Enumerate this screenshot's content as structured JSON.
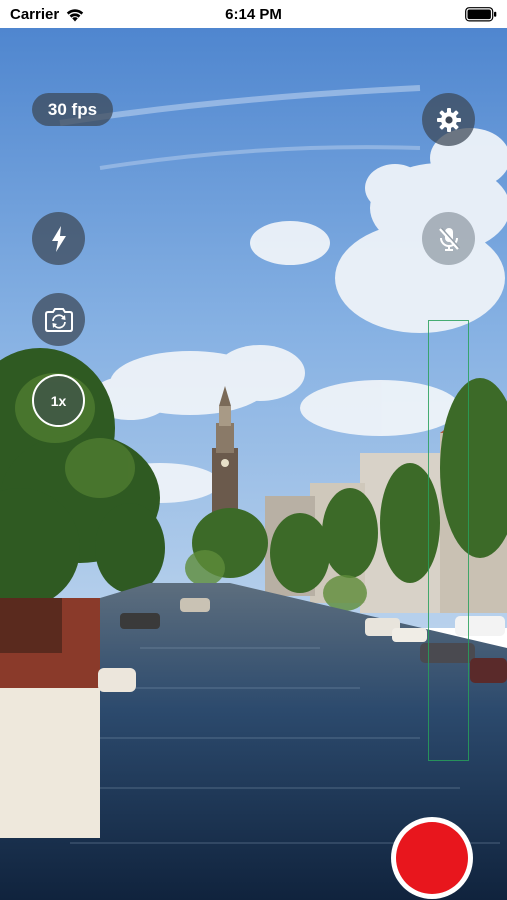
{
  "status_bar": {
    "carrier": "Carrier",
    "time": "6:14 PM",
    "icons": [
      "wifi-icon",
      "battery-icon"
    ]
  },
  "camera": {
    "fps_label": "30 fps",
    "zoom_label": "1x",
    "buttons": {
      "settings": "gear-icon",
      "flash": "lightning-icon",
      "switch_camera": "camera-rotate-icon",
      "microphone": "microphone-muted-icon",
      "record": "record-icon"
    },
    "colors": {
      "overlay_button": "#3c4655",
      "record": "#e8161d",
      "level_meter": "#28a05a"
    }
  }
}
